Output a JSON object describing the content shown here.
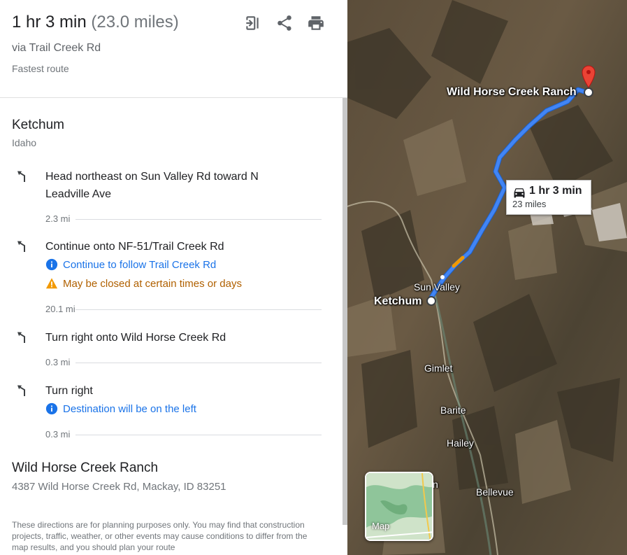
{
  "summary": {
    "duration": "1 hr 3 min",
    "distance": "(23.0 miles)",
    "via": "via Trail Creek Rd",
    "note": "Fastest route"
  },
  "toolbar": {
    "send_icon": "send-to-phone-icon",
    "share_icon": "share-icon",
    "print_icon": "print-icon"
  },
  "origin": {
    "name": "Ketchum",
    "region": "Idaho"
  },
  "steps": [
    {
      "icon": "turn-slight-left-icon",
      "text": "Head northeast on Sun Valley Rd toward N Leadville Ave",
      "distance": "2.3 mi"
    },
    {
      "icon": "turn-slight-left-icon",
      "text": "Continue onto NF-51/Trail Creek Rd",
      "info": "Continue to follow Trail Creek Rd",
      "warning": "May be closed at certain times or days",
      "distance": "20.1 mi"
    },
    {
      "icon": "turn-slight-left-icon",
      "text": "Turn right onto Wild Horse Creek Rd",
      "distance": "0.3 mi"
    },
    {
      "icon": "turn-slight-left-icon",
      "text": "Turn right",
      "info": "Destination will be on the left",
      "distance": "0.3 mi"
    }
  ],
  "destination": {
    "name": "Wild Horse Creek Ranch",
    "address": "4387 Wild Horse Creek Rd, Mackay, ID 83251"
  },
  "disclaimer": "These directions are for planning purposes only. You may find that construction projects, traffic, weather, or other events may cause conditions to differ from the map results, and you should plan your route",
  "map": {
    "labels": {
      "destination": "Wild Horse Creek Ranch",
      "origin": "Ketchum",
      "sun_valley": "Sun Valley",
      "gimlet": "Gimlet",
      "barite": "Barite",
      "hailey": "Hailey",
      "bellevue": "Bellevue",
      "partial_n": "n"
    },
    "route_card": {
      "time": "1 hr 3 min",
      "miles": "23 miles"
    },
    "toggle_label": "Map",
    "colors": {
      "route": "#4285f4",
      "route_warning": "#f29900",
      "pin": "#ea4335",
      "info": "#1a73e8",
      "warning": "#b06000"
    }
  }
}
